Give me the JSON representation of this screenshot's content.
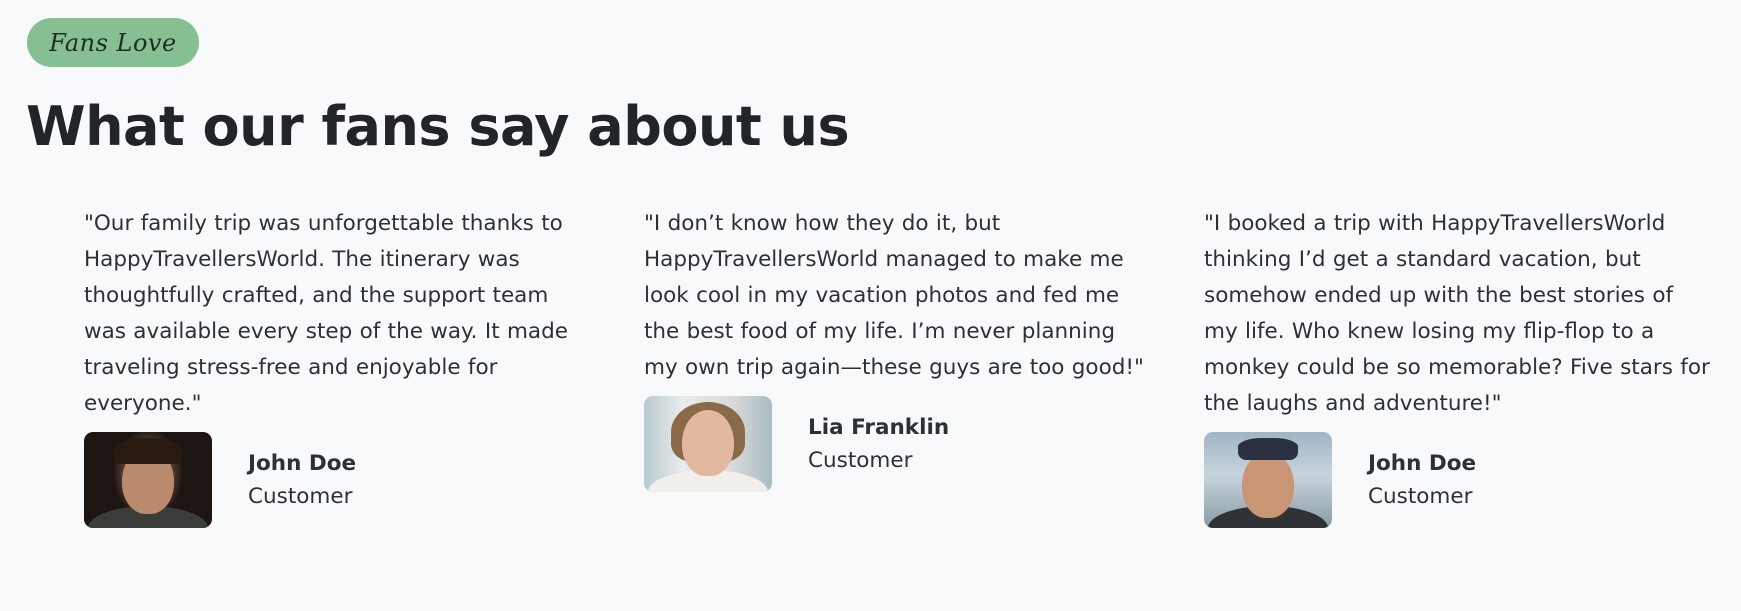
{
  "section": {
    "badge": "Fans Love",
    "heading": "What our fans say about us"
  },
  "testimonials": [
    {
      "quote": "\"Our family trip was unforgettable thanks to HappyTravellersWorld. The itinerary was thoughtfully crafted, and the support team was available every step of the way. It made traveling stress-free and enjoyable for everyone.\"",
      "name": "John Doe",
      "role": "Customer"
    },
    {
      "quote": "\"I don’t know how they do it, but HappyTravellersWorld managed to make me look cool in my vacation photos and fed me the best food of my life. I’m never planning my own trip again—these guys are too good!\"",
      "name": "Lia Franklin",
      "role": "Customer"
    },
    {
      "quote": "\"I booked a trip with HappyTravellersWorld thinking I’d get a standard vacation, but somehow ended up with the best stories of my life. Who knew losing my flip-flop to a monkey could be so memorable? Five stars for the laughs and adventure!\"",
      "name": "John Doe",
      "role": "Customer"
    }
  ]
}
